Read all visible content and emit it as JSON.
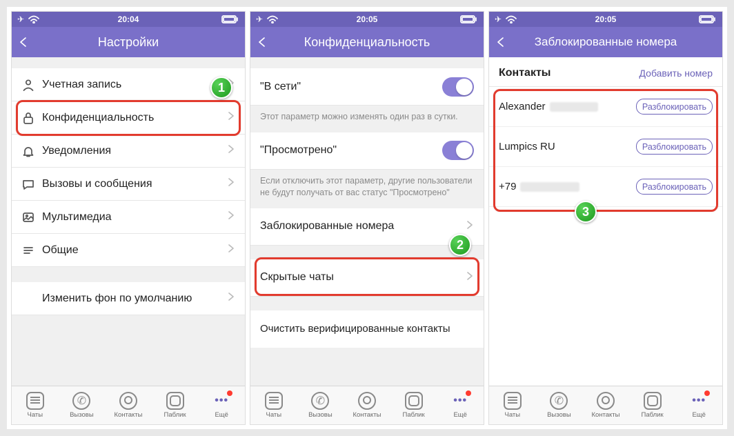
{
  "status": {
    "time1": "20:04",
    "time2": "20:05",
    "time3": "20:05"
  },
  "screen1": {
    "title": "Настройки",
    "items": {
      "account": "Учетная запись",
      "privacy": "Конфиденциальность",
      "notifications": "Уведомления",
      "calls": "Вызовы и сообщения",
      "media": "Мультимедиа",
      "general": "Общие",
      "changeBg": "Изменить фон по умолчанию"
    }
  },
  "screen2": {
    "title": "Конфиденциальность",
    "online": {
      "label": "\"В сети\"",
      "desc": "Этот параметр можно изменять один раз в сутки."
    },
    "seen": {
      "label": "\"Просмотрено\"",
      "desc": "Если отключить этот параметр, другие пользователи не будут получать от вас статус \"Просмотрено\""
    },
    "blocked": "Заблокированные номера",
    "hidden": "Скрытые чаты",
    "clear": "Очистить верифицированные контакты"
  },
  "screen3": {
    "title": "Заблокированные номера",
    "sectionTitle": "Контакты",
    "add": "Добавить номер",
    "contacts": [
      {
        "name": "Alexander",
        "btn": "Разблокировать",
        "blur": true
      },
      {
        "name": "Lumpics RU",
        "btn": "Разблокировать",
        "blur": false
      },
      {
        "name": "+79",
        "btn": "Разблокировать",
        "blur": true
      }
    ]
  },
  "tabs": {
    "chats": "Чаты",
    "calls": "Вызовы",
    "contacts": "Контакты",
    "public": "Паблик",
    "more": "Ещё"
  }
}
